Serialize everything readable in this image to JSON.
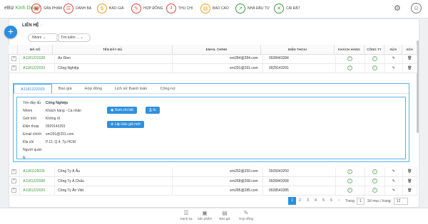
{
  "app": {
    "brand_prefix": "eBiz",
    "brand_name": "Kinh Doanh"
  },
  "nav": [
    {
      "label": "SẢN PHẨM",
      "icon": "box-icon",
      "color": "#e0483a",
      "glyph": "▣"
    },
    {
      "label": "DANH BẠ",
      "icon": "contacts-icon",
      "color": "#e0483a",
      "glyph": "☰"
    },
    {
      "label": "BÁO GIÁ",
      "icon": "quote-icon",
      "color": "#f0a020",
      "glyph": "$"
    },
    {
      "label": "HỢP ĐỒNG",
      "icon": "contract-icon",
      "color": "#e0483a",
      "glyph": "✎"
    },
    {
      "label": "THU CHI",
      "icon": "money-icon",
      "color": "#e0483a",
      "glyph": "₫"
    },
    {
      "label": "BÁO CÁO",
      "icon": "report-icon",
      "color": "#f0a020",
      "glyph": "▤"
    },
    {
      "label": "NHÀ ĐẦU TƯ",
      "icon": "investor-icon",
      "color": "#3a9b3c",
      "glyph": "↗"
    },
    {
      "label": "CÀI ĐẶT",
      "icon": "settings-tools-icon",
      "color": "#3a9b3c",
      "glyph": "✕"
    }
  ],
  "page": {
    "title": "LIÊN HỆ",
    "filter_group": "Nhóm",
    "search_placeholder": "Tìm kiếm ..."
  },
  "table": {
    "headers": [
      "MÃ SỐ",
      "TÊN ĐẦY ĐỦ",
      "EMAIL CHÍNH",
      "ĐIỆN THOẠI",
      "KHÁCH HÀNG",
      "CÔNG TY",
      "SỬA",
      "XÓA"
    ],
    "top_rows": [
      {
        "code": "A1181222028",
        "name": "An Dien",
        "email": "em284@284.com",
        "phone": "0928443284",
        "customer": true
      },
      {
        "code": "A1181222033",
        "name": "Công Nghiệp",
        "email": "em291@291.com",
        "phone": "0929143291",
        "customer": true
      }
    ],
    "bottom_rows": [
      {
        "code": "A1181129036",
        "name": "Công Ty Á Âu",
        "email": "em250@250.com",
        "phone": "0925043250",
        "customer": true
      },
      {
        "code": "A1181222008",
        "name": "Công Ty Á Châu",
        "email": "em268@268.com",
        "phone": "0926843268",
        "customer": true
      },
      {
        "code": "A1181222029",
        "name": "Công Ty Ân Việt",
        "email": "em285@285.com",
        "phone": "0928543285",
        "customer": true
      }
    ]
  },
  "detail": {
    "tabs": [
      "A1181222033",
      "Báo giá",
      "Hợp đồng",
      "Lịch sử thanh toán",
      "Công nợ"
    ],
    "fields": [
      {
        "k": "Tên đầy đủ",
        "v": "Công Nghiệp"
      },
      {
        "k": "Nhóm",
        "v": "Khách hàng - Cá nhân"
      },
      {
        "k": "Giới tính",
        "v": "Không rõ"
      },
      {
        "k": "Điện thoại",
        "v": "0929143291"
      },
      {
        "k": "Email chính",
        "v": "em291@291.com"
      },
      {
        "k": "Địa chỉ",
        "v": "P.12, Q.4, Tp.HCM"
      },
      {
        "k": "Người quản lý",
        "v": ""
      }
    ],
    "btn_view": "Xem chi tiết",
    "btn_print": "In",
    "btn_quote": "Lập báo giá mới"
  },
  "pager": {
    "pages": [
      "1",
      "2",
      "3",
      "4",
      "5",
      "6"
    ],
    "current": "1",
    "trang": "Trang",
    "page_input": "1",
    "per_page_label": "Số mục / trang:",
    "per_page": "12"
  },
  "footer": [
    {
      "label": "Danh bạ",
      "icon": "contacts-icon",
      "glyph": "☰"
    },
    {
      "label": "Sản phẩm",
      "icon": "box-icon",
      "glyph": "▣"
    },
    {
      "label": "Báo giá",
      "icon": "quote-icon",
      "glyph": "▤"
    },
    {
      "label": "Hợp đồng",
      "icon": "contract-icon",
      "glyph": "✎"
    }
  ]
}
